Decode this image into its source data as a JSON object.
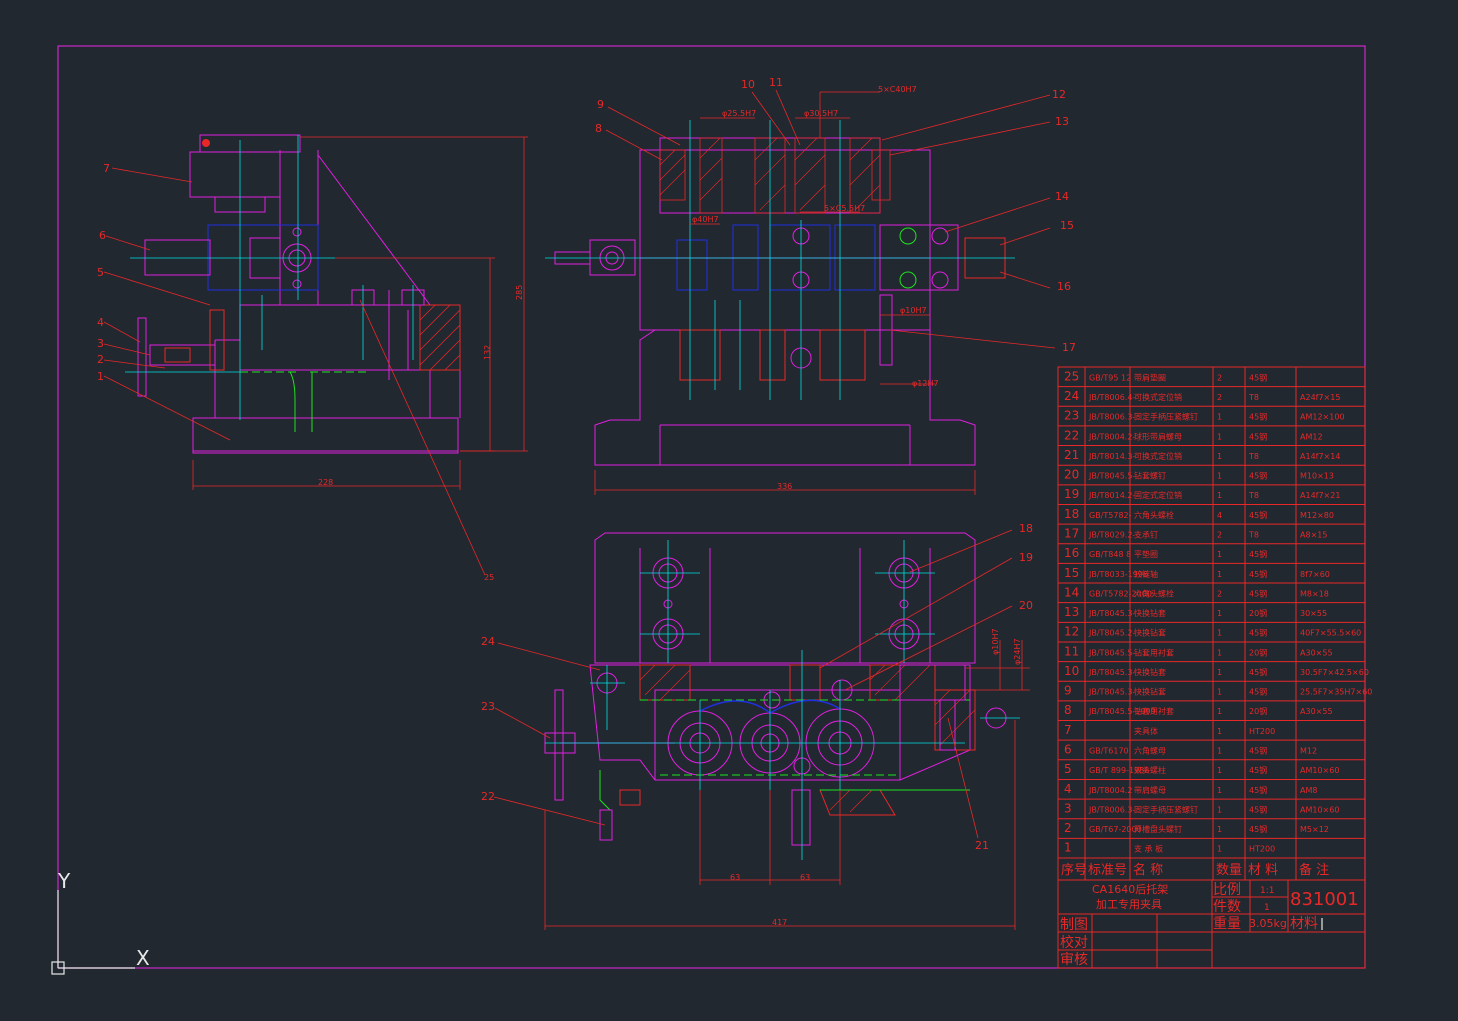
{
  "colors": {
    "background": "#212830",
    "frame": "#c828c8",
    "part": "#e020e0",
    "center": "#00e0e0",
    "red": "#e82828",
    "blue": "#2030e0",
    "green": "#20e020",
    "white": "#e8e8e8",
    "yellow": "#e0d020"
  },
  "callouts": {
    "left_view": [
      "7",
      "6",
      "5",
      "4",
      "3",
      "2",
      "1"
    ],
    "left_extra": "25",
    "front_view": [
      "9",
      "8",
      "10",
      "11",
      "12",
      "13",
      "14",
      "15",
      "16",
      "17"
    ],
    "plan_view": [
      "18",
      "19",
      "20",
      "24",
      "23",
      "22",
      "21"
    ]
  },
  "dimensions": {
    "left_width": "228",
    "left_h1": "132",
    "left_h2": "285",
    "front_width": "336",
    "front_d1": "φ25.5H7",
    "front_d2": "φ30.5H7",
    "front_d3": "5×C40H7",
    "front_d4": "φ40H7",
    "front_d5": "5×C5.5H7",
    "front_d6": "φ10H7",
    "front_d7": "φ12H7",
    "plan_w1": "63",
    "plan_w2": "63",
    "plan_width": "417",
    "plan_d1": "φ10H7",
    "plan_d2": "φ24H7"
  },
  "bom": {
    "rows": [
      {
        "no": "25",
        "std": "GB/T95 12",
        "name": "带肩垫圈",
        "qty": "2",
        "mat": "45钢",
        "note": ""
      },
      {
        "no": "24",
        "std": "JB/T8006.4-",
        "name": "可换式定位销",
        "qty": "2",
        "mat": "T8",
        "note": "A24f7×15"
      },
      {
        "no": "23",
        "std": "JB/T8006.3-",
        "name": "固定手柄压紧螺钉",
        "qty": "1",
        "mat": "45钢",
        "note": "AM12×100"
      },
      {
        "no": "22",
        "std": "JB/T8004.2-",
        "name": "球形带肩螺母",
        "qty": "1",
        "mat": "45钢",
        "note": "AM12"
      },
      {
        "no": "21",
        "std": "JB/T8014.3-",
        "name": "可换式定位销",
        "qty": "1",
        "mat": "T8",
        "note": "A14f7×14"
      },
      {
        "no": "20",
        "std": "JB/T8045.5-",
        "name": "钻套螺钉",
        "qty": "1",
        "mat": "45钢",
        "note": "M10×13"
      },
      {
        "no": "19",
        "std": "JB/T8014.2-",
        "name": "固定式定位销",
        "qty": "1",
        "mat": "T8",
        "note": "A14f7×21"
      },
      {
        "no": "18",
        "std": "GB/T5782-",
        "name": "六角头螺栓",
        "qty": "4",
        "mat": "45钢",
        "note": "M12×80"
      },
      {
        "no": "17",
        "std": "JB/T8029.2-",
        "name": "支承钉",
        "qty": "2",
        "mat": "T8",
        "note": "A8×15"
      },
      {
        "no": "16",
        "std": "GB/T848 8",
        "name": "平垫圈",
        "qty": "1",
        "mat": "45钢",
        "note": ""
      },
      {
        "no": "15",
        "std": "JB/T8033-1996",
        "name": "铰链轴",
        "qty": "1",
        "mat": "45钢",
        "note": "8f7×60"
      },
      {
        "no": "14",
        "std": "GB/T5782-2000",
        "name": "六角头螺栓",
        "qty": "2",
        "mat": "45钢",
        "note": "M8×18"
      },
      {
        "no": "13",
        "std": "JB/T8045.3-",
        "name": "快换钻套",
        "qty": "1",
        "mat": "20钢",
        "note": "30×55"
      },
      {
        "no": "12",
        "std": "JB/T8045.2-",
        "name": "快换钻套",
        "qty": "1",
        "mat": "45钢",
        "note": "40F7×55.5×60"
      },
      {
        "no": "11",
        "std": "JB/T8045.5-",
        "name": "钻套用衬套",
        "qty": "1",
        "mat": "20钢",
        "note": "A30×55"
      },
      {
        "no": "10",
        "std": "JB/T8045.3-",
        "name": "快换钻套",
        "qty": "1",
        "mat": "45钢",
        "note": "30.5F7×42.5×60"
      },
      {
        "no": "9",
        "std": "JB/T8045.3-",
        "name": "快换钻套",
        "qty": "1",
        "mat": "45钢",
        "note": "25.5F7×35H7×60"
      },
      {
        "no": "8",
        "std": "JB/T8045.5-1999",
        "name": "钻套用衬套",
        "qty": "1",
        "mat": "20钢",
        "note": "A30×55"
      },
      {
        "no": "7",
        "std": "",
        "name": "夹具体",
        "qty": "1",
        "mat": "HT200",
        "note": ""
      },
      {
        "no": "6",
        "std": "GB/T6170",
        "name": "六角螺母",
        "qty": "1",
        "mat": "45钢",
        "note": "M12"
      },
      {
        "no": "5",
        "std": "GB/T 899-1988",
        "name": "双头螺柱",
        "qty": "1",
        "mat": "45钢",
        "note": "AM10×60"
      },
      {
        "no": "4",
        "std": "JB/T8004.2",
        "name": "带肩螺母",
        "qty": "1",
        "mat": "45钢",
        "note": "AM8"
      },
      {
        "no": "3",
        "std": "JB/T8006.3-",
        "name": "固定手柄压紧螺钉",
        "qty": "1",
        "mat": "45钢",
        "note": "AM10×60"
      },
      {
        "no": "2",
        "std": "GB/T67-2000",
        "name": "开槽盘头螺钉",
        "qty": "1",
        "mat": "45钢",
        "note": "M5×12"
      },
      {
        "no": "1",
        "std": "",
        "name": "支 承 板",
        "qty": "1",
        "mat": "HT200",
        "note": ""
      }
    ],
    "headers": {
      "no": "序号",
      "std": "标准号",
      "name": "名  称",
      "qty": "数量",
      "mat": "材 料",
      "note": "备 注"
    }
  },
  "title_block": {
    "title_line1": "CA1640后托架",
    "title_line2": "加工专用夹具",
    "scale_label": "比例",
    "scale_value": "1:1",
    "count_label": "件数",
    "count_value": "1",
    "weight_label": "重量",
    "weight_value": "3.05kg",
    "material_label": "材料",
    "drawing_no": "831001",
    "draw_label": "制图",
    "check_label": "校对",
    "review_label": "审核"
  },
  "ucs": {
    "x_label": "X",
    "y_label": "Y"
  }
}
